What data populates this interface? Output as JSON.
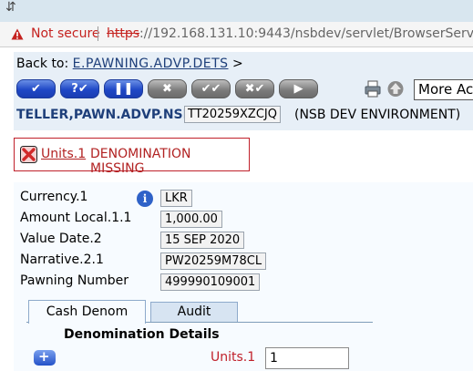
{
  "browser": {
    "security_label": "Not secure",
    "url_scheme": "https",
    "url_rest": "://192.168.131.10:9443/nsbdev/servlet/BrowserServlet"
  },
  "header": {
    "back_prefix": "Back to:",
    "back_link": "E.PAWNING.ADVP.DETS",
    "back_suffix": ">"
  },
  "toolbar": {
    "buttons": [
      {
        "name": "commit",
        "glyph": "✔",
        "style": "blue"
      },
      {
        "name": "validate",
        "glyph": "?✔",
        "style": "blue"
      },
      {
        "name": "hold",
        "glyph": "❚❚",
        "style": "blue"
      },
      {
        "name": "delete",
        "glyph": "✖",
        "style": "grey"
      },
      {
        "name": "authorise",
        "glyph": "✔✔",
        "style": "grey"
      },
      {
        "name": "reverse",
        "glyph": "✖✔",
        "style": "grey"
      },
      {
        "name": "next",
        "glyph": "▶",
        "style": "grey"
      }
    ],
    "more_actions": "More Actions"
  },
  "record": {
    "application": "TELLER,PAWN.ADVP.NSB",
    "transaction_id": "TT20259XZCJQ",
    "environment": "(NSB DEV ENVIRONMENT)"
  },
  "error": {
    "field_link": "Units.1",
    "message": "DENOMINATION MISSING"
  },
  "fields": [
    {
      "label": "Currency.1",
      "value": "LKR"
    },
    {
      "label": "Amount Local.1.1",
      "value": "1,000.00"
    },
    {
      "label": "Value Date.2",
      "value": "15 SEP 2020"
    },
    {
      "label": "Narrative.2.1",
      "value": "PW20259M78CL"
    },
    {
      "label": "Pawning Number",
      "value": "499990109001"
    }
  ],
  "tabs": [
    {
      "label": "Cash Denom",
      "active": true
    },
    {
      "label": "Audit",
      "active": false
    }
  ],
  "denomination": {
    "title": "Denomination Details",
    "units_label": "Units.1",
    "units_value": "1"
  },
  "colors": {
    "panel_bg": "#e7eff7",
    "error_red": "#c0202a",
    "link_blue": "#1e3f7a"
  }
}
